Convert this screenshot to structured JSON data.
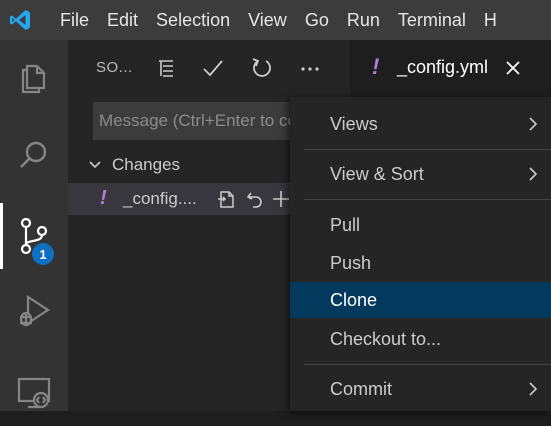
{
  "menubar": {
    "items": [
      "File",
      "Edit",
      "Selection",
      "View",
      "Go",
      "Run",
      "Terminal",
      "H"
    ]
  },
  "activity": {
    "icons": [
      "explorer-icon",
      "search-icon",
      "source-control-icon",
      "run-debug-icon",
      "remote-explorer-icon"
    ],
    "badge": "1"
  },
  "sidebar": {
    "title": "SO...",
    "header_icons": [
      "view-as-tree-icon",
      "commit-check-icon",
      "refresh-icon",
      "more-actions-icon"
    ],
    "commit_placeholder": "Message (Ctrl+Enter to commit)",
    "changes_label": "Changes",
    "file": {
      "status": "!",
      "name": "_config....",
      "actions": [
        "open-file-icon",
        "discard-changes-icon",
        "stage-changes-icon"
      ]
    }
  },
  "editor": {
    "tab": {
      "icon": "!",
      "label": "_config.yml"
    }
  },
  "context_menu": {
    "items": [
      {
        "label": "Views",
        "submenu": true
      },
      {
        "label": "View & Sort",
        "submenu": true
      },
      {
        "label": "Pull",
        "submenu": false
      },
      {
        "label": "Push",
        "submenu": false
      },
      {
        "label": "Clone",
        "submenu": false,
        "highlighted": true
      },
      {
        "label": "Checkout to...",
        "submenu": false
      },
      {
        "label": "Commit",
        "submenu": true
      }
    ]
  },
  "colors": {
    "titlebar": "#3c3c3c",
    "activitybar": "#333333",
    "sidebar": "#252526",
    "editor": "#1e1e1e",
    "highlight": "#04395e",
    "badge": "#0e70c0",
    "warning_glyph": "#b180d7"
  }
}
